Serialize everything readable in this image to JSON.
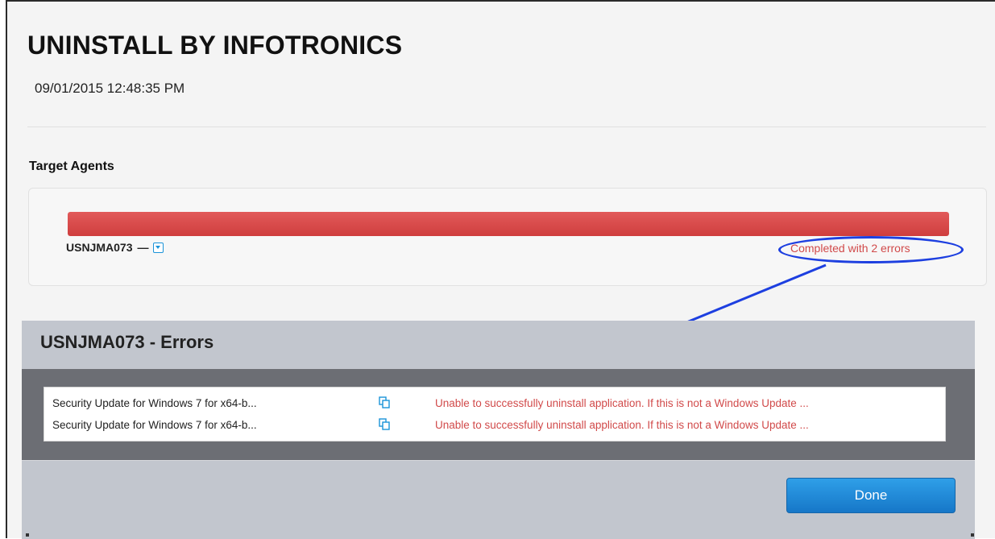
{
  "header": {
    "title": "UNINSTALL BY INFOTRONICS",
    "timestamp": "09/01/2015 12:48:35 PM"
  },
  "target_agents": {
    "label": "Target Agents",
    "agent": {
      "name": "USNJMA073",
      "separator": "—",
      "status": "Completed with 2 errors",
      "progress_percent": 100,
      "progress_color": "#d94848"
    }
  },
  "errors_dialog": {
    "title": "USNJMA073 - Errors",
    "rows": [
      {
        "application": "Security Update for Windows 7 for x64-b...",
        "icon": "copy-icon",
        "message": "Unable to successfully uninstall application. If this is not a Windows Update ..."
      },
      {
        "application": "Security Update for Windows 7 for x64-b...",
        "icon": "copy-icon",
        "message": "Unable to successfully uninstall application. If this is not a Windows Update ..."
      }
    ],
    "done_label": "Done"
  },
  "colors": {
    "error_text": "#d14a4a",
    "accent_blue": "#1a93d8",
    "annotation_blue": "#1d3fe0"
  }
}
